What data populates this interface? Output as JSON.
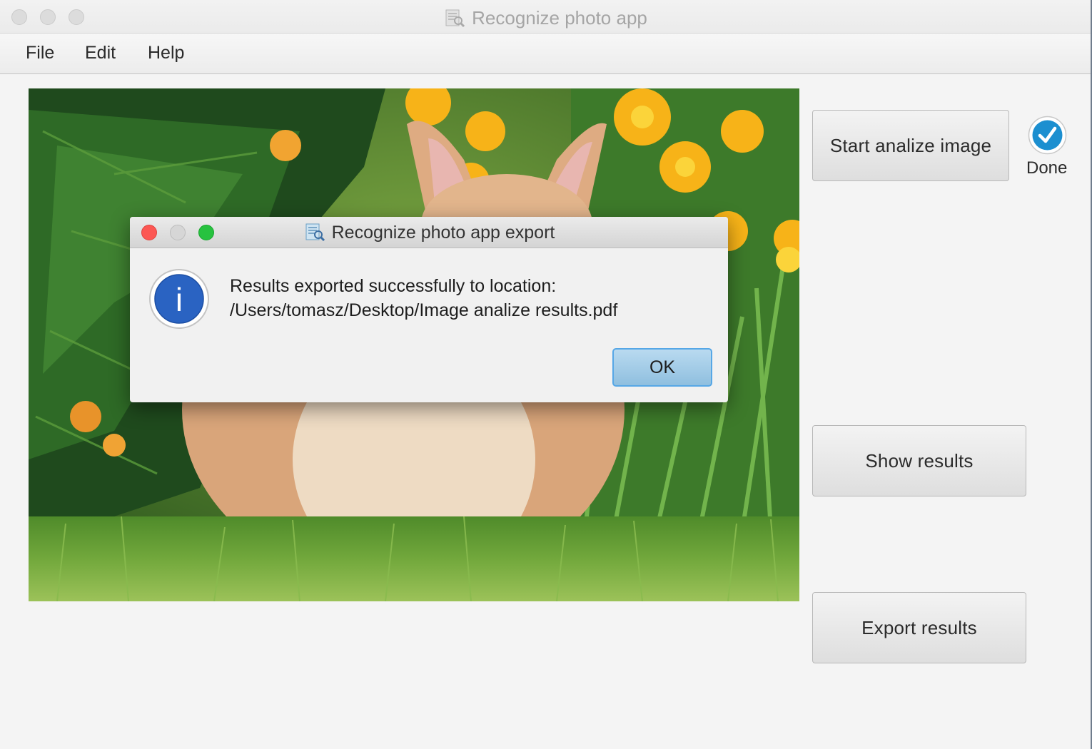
{
  "window": {
    "title": "Recognize photo app",
    "title_icon": "app-icon",
    "traffic_lights": [
      "close",
      "minimize",
      "zoom"
    ]
  },
  "menubar": {
    "items": [
      {
        "label": "File"
      },
      {
        "label": "Edit"
      },
      {
        "label": "Help"
      }
    ]
  },
  "image_view": {
    "subject": "corgi puppy among pine branches, orange and yellow lilies, on grass"
  },
  "buttons": {
    "analyze": "Start analize image",
    "show_results": "Show results",
    "export_results": "Export results"
  },
  "status": {
    "label": "Done",
    "icon": "checkmark-icon",
    "color": "#1c8fd0"
  },
  "dialog": {
    "title": "Recognize photo app export",
    "icon": "info-icon",
    "message_line1": "Results exported successfully to location:",
    "message_line2": "/Users/tomasz/Desktop/Image analize results.pdf",
    "ok_label": "OK",
    "traffic_colors": [
      "#fc5753",
      "#d0d0d0",
      "#27c23f"
    ]
  },
  "colors": {
    "accent": "#56a7e6",
    "info_blue": "#2a63c2"
  }
}
